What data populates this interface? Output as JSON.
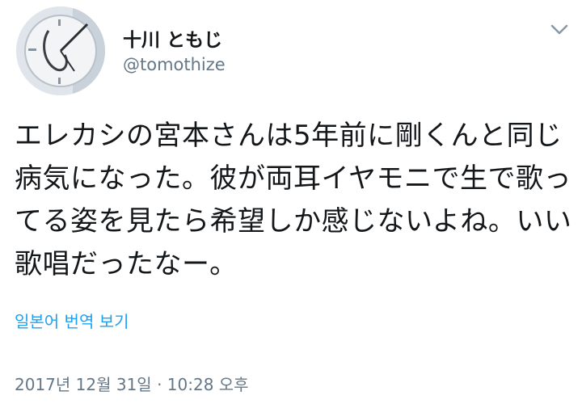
{
  "user": {
    "display_name": "十川 ともじ",
    "handle": "@tomothize"
  },
  "tweet": {
    "text": "エレカシの宮本さんは5年前に剛くんと同じ病気になった。彼が両耳イヤモニで生で歌ってる姿を見たら希望しか感じないよね。いい歌唱だったなー。",
    "translate_label": "일본어 번역 보기",
    "timestamp": "2017년 12월 31일 · 10:28 오후"
  },
  "icons": {
    "avatar": "clock-wall-avatar",
    "menu": "chevron-down-icon"
  },
  "colors": {
    "link": "#1da1f2",
    "secondary_text": "#657786",
    "primary_text": "#14171a"
  }
}
